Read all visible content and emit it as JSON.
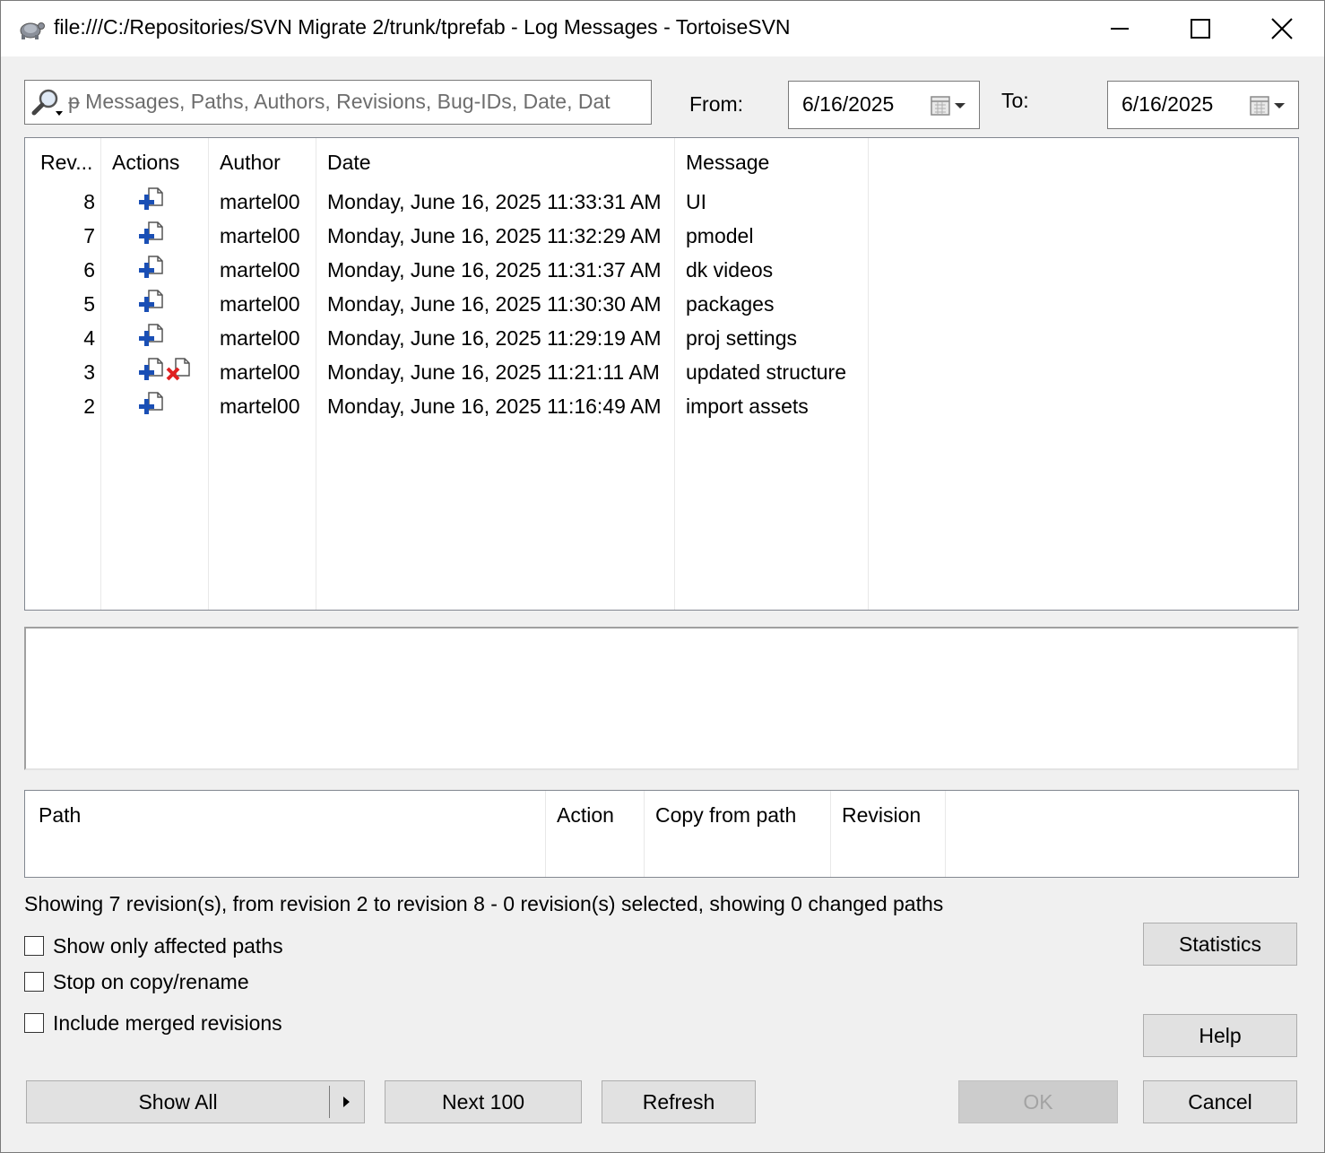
{
  "window": {
    "title": "file:///C:/Repositories/SVN Migrate 2/trunk/tprefab - Log Messages - TortoiseSVN",
    "app_icon": "tortoise-icon"
  },
  "filter": {
    "search_text": "ᵽ Messages, Paths, Authors, Revisions, Bug-IDs, Date, Dat",
    "from_label": "From:",
    "from_date": "6/16/2025",
    "to_label": "To:",
    "to_date": "6/16/2025"
  },
  "log": {
    "columns": [
      "Rev...",
      "Actions",
      "Author",
      "Date",
      "Message"
    ],
    "rows": [
      {
        "rev": "8",
        "actions": [
          "added"
        ],
        "author": "martel00",
        "date": "Monday, June 16, 2025 11:33:31 AM",
        "message": "UI"
      },
      {
        "rev": "7",
        "actions": [
          "added"
        ],
        "author": "martel00",
        "date": "Monday, June 16, 2025 11:32:29 AM",
        "message": "pmodel"
      },
      {
        "rev": "6",
        "actions": [
          "added"
        ],
        "author": "martel00",
        "date": "Monday, June 16, 2025 11:31:37 AM",
        "message": "dk videos"
      },
      {
        "rev": "5",
        "actions": [
          "added"
        ],
        "author": "martel00",
        "date": "Monday, June 16, 2025 11:30:30 AM",
        "message": "packages"
      },
      {
        "rev": "4",
        "actions": [
          "added"
        ],
        "author": "martel00",
        "date": "Monday, June 16, 2025 11:29:19 AM",
        "message": "proj settings"
      },
      {
        "rev": "3",
        "actions": [
          "added",
          "deleted"
        ],
        "author": "martel00",
        "date": "Monday, June 16, 2025 11:21:11 AM",
        "message": "updated structure"
      },
      {
        "rev": "2",
        "actions": [
          "added"
        ],
        "author": "martel00",
        "date": "Monday, June 16, 2025 11:16:49 AM",
        "message": "import assets"
      }
    ]
  },
  "paths": {
    "columns": [
      "Path",
      "Action",
      "Copy from path",
      "Revision"
    ]
  },
  "status_text": "Showing 7 revision(s), from revision 2 to revision 8 - 0 revision(s) selected, showing 0 changed paths",
  "options": {
    "show_only_affected": {
      "label": "Show only affected paths",
      "checked": false
    },
    "stop_on_copy": {
      "label": "Stop on copy/rename",
      "checked": false
    },
    "include_merged": {
      "label": "Include merged revisions",
      "checked": false
    }
  },
  "buttons": {
    "statistics": "Statistics",
    "help": "Help",
    "show_all": "Show All",
    "next_100": "Next 100",
    "refresh": "Refresh",
    "ok": "OK",
    "cancel": "Cancel"
  },
  "colors": {
    "add_icon": "#1a4fb5",
    "delete_icon": "#e02020"
  }
}
